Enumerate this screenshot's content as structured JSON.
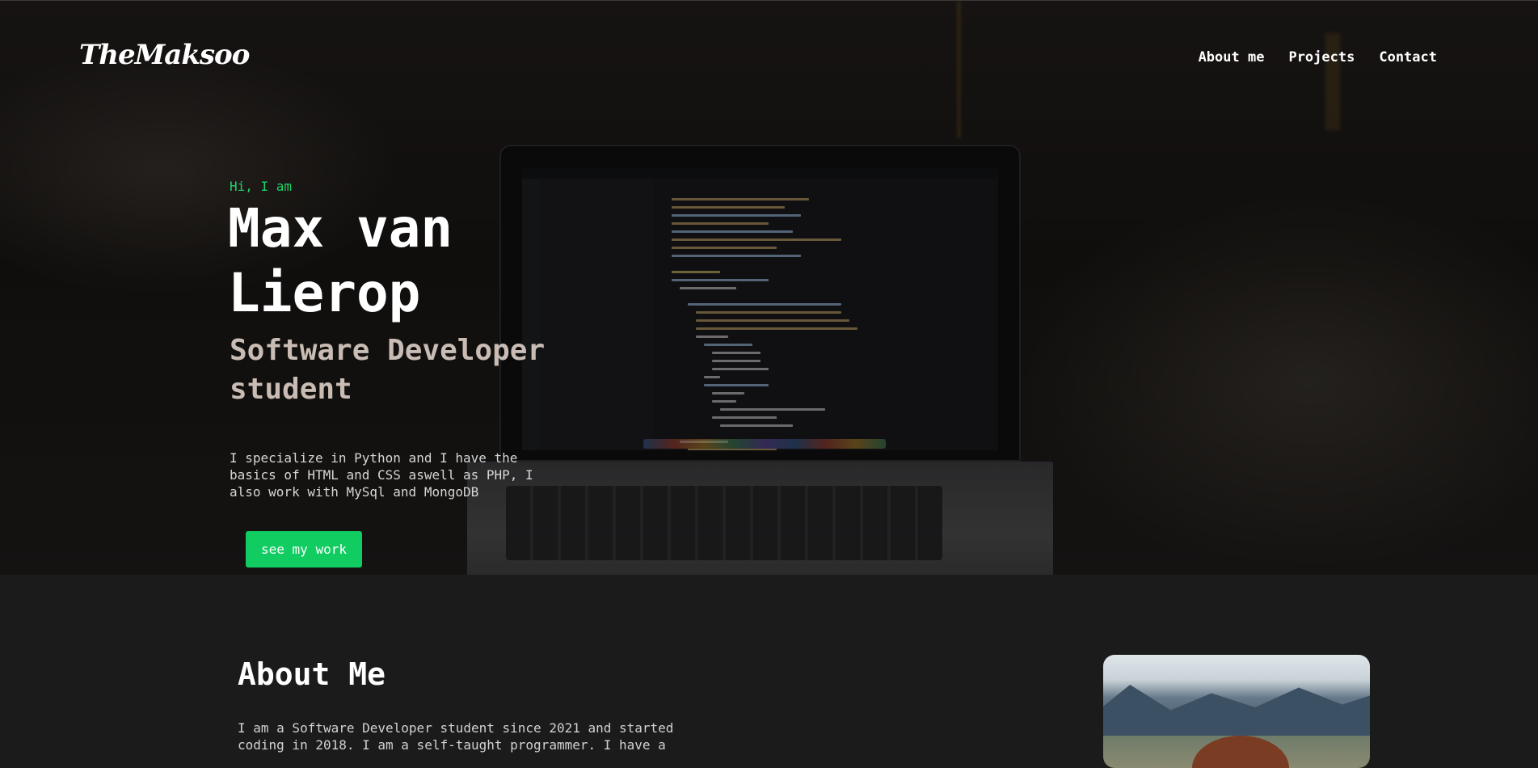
{
  "brand": {
    "logo": "TheMaksoo"
  },
  "nav": {
    "items": [
      "About me",
      "Projects",
      "Contact"
    ]
  },
  "hero": {
    "greeting": "Hi, I am",
    "name": "Max van Lierop",
    "role": "Software Developer student",
    "intro": "I specialize in Python and I have the basics of HTML and CSS aswell as PHP, I also work with MySql and MongoDB",
    "cta_label": "see my work"
  },
  "about": {
    "title": "About Me",
    "text": "I am a Software Developer student since 2021 and started coding in 2018. I am a self-taught programmer. I have a"
  },
  "colors": {
    "accent": "#10cc61",
    "background": "#1b1b1b",
    "greeting": "#20d46a",
    "role": "#c9bcb4"
  }
}
